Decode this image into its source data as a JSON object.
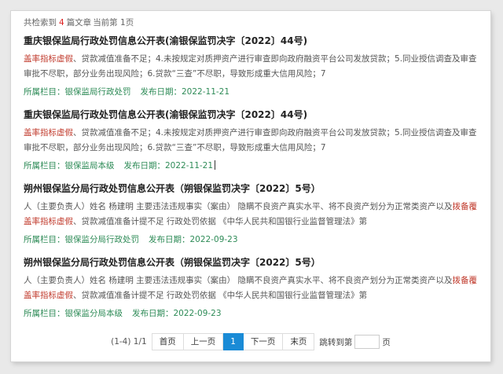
{
  "summary": {
    "prefix": "共检索到",
    "count": "4",
    "suffix": "篇文章",
    "page_text": "当前第 1页"
  },
  "items": [
    {
      "title": "重庆银保监局行政处罚信息公开表(渝银保监罚决字〔2022〕44号)",
      "body_hl": "盖率指标虚假",
      "body_rest": "、贷款减值准备不足；4.未按规定对质押资产进行审查即向政府融资平台公司发放贷款；5.同业授信调查及审查审批不尽职，部分业务出现风险；6.贷款“三查”不尽职，导致形成重大信用风险；7",
      "meta_column": "所属栏目：银保监局行政处罚",
      "meta_date": "发布日期：2022-11-21"
    },
    {
      "title": "重庆银保监局行政处罚信息公开表(渝银保监罚决字〔2022〕44号)",
      "body_hl": "盖率指标虚假",
      "body_rest": "、贷款减值准备不足；4.未按规定对质押资产进行审查即向政府融资平台公司发放贷款；5.同业授信调查及审查审批不尽职，部分业务出现风险；6.贷款“三查”不尽职，导致形成重大信用风险；7",
      "meta_column": "所属栏目：银保监局本级",
      "meta_date": "发布日期：2022-11-21"
    },
    {
      "title": "朔州银保监分局行政处罚信息公开表（朔银保监罚决字〔2022〕5号）",
      "body_pre": "人（主要负责人）姓名 杨建明 主要违法违规事实（案由） 隐瞒不良资产真实水平、将不良资产划分为正常类资产以及",
      "body_hl": "拨备覆盖率指标虚假",
      "body_rest": "、贷款减值准备计提不足 行政处罚依据 《中华人民共和国银行业监督管理法》第",
      "meta_column": "所属栏目：银保监分局行政处罚",
      "meta_date": "发布日期：2022-09-23"
    },
    {
      "title": "朔州银保监分局行政处罚信息公开表（朔银保监罚决字〔2022〕5号）",
      "body_pre": "人（主要负责人）姓名 杨建明 主要违法违规事实（案由） 隐瞒不良资产真实水平、将不良资产划分为正常类资产以及",
      "body_hl": "拨备覆盖率指标虚假",
      "body_rest": "、贷款减值准备计提不足 行政处罚依据 《中华人民共和国银行业监督管理法》第",
      "meta_column": "所属栏目：银保监分局本级",
      "meta_date": "发布日期：2022-09-23"
    }
  ],
  "pager": {
    "info": "(1-4) 1/1",
    "first": "首页",
    "prev": "上一页",
    "current": "1",
    "next": "下一页",
    "last": "末页",
    "jump_prefix": "跳转到第",
    "jump_suffix": "页"
  },
  "colors": {
    "highlight": "#c0392b",
    "meta": "#2e8b57",
    "count": "#dd2222",
    "pager_active": "#1a8bd6"
  }
}
